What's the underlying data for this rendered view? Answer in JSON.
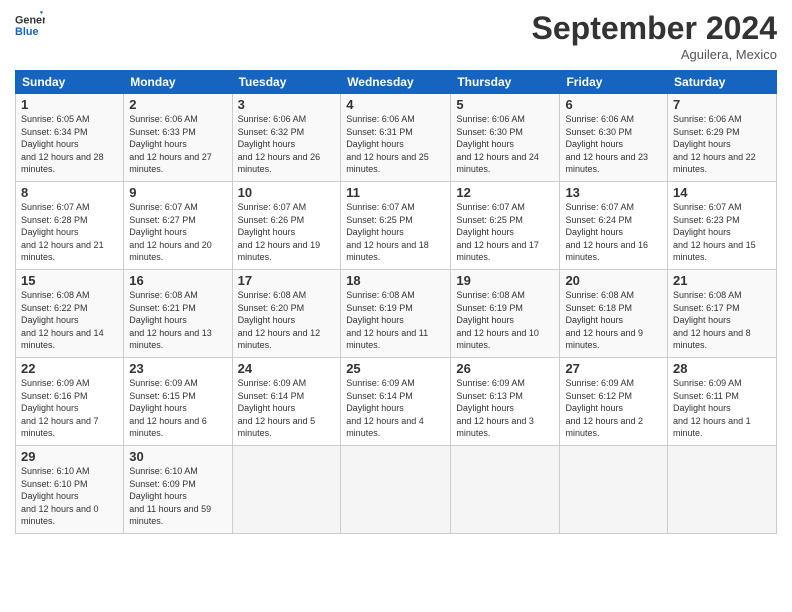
{
  "header": {
    "logo_line1": "General",
    "logo_line2": "Blue",
    "month": "September 2024",
    "location": "Aguilera, Mexico"
  },
  "weekdays": [
    "Sunday",
    "Monday",
    "Tuesday",
    "Wednesday",
    "Thursday",
    "Friday",
    "Saturday"
  ],
  "weeks": [
    [
      {
        "day": "1",
        "sunrise": "6:05 AM",
        "sunset": "6:34 PM",
        "daylight": "12 hours and 28 minutes."
      },
      {
        "day": "2",
        "sunrise": "6:06 AM",
        "sunset": "6:33 PM",
        "daylight": "12 hours and 27 minutes."
      },
      {
        "day": "3",
        "sunrise": "6:06 AM",
        "sunset": "6:32 PM",
        "daylight": "12 hours and 26 minutes."
      },
      {
        "day": "4",
        "sunrise": "6:06 AM",
        "sunset": "6:31 PM",
        "daylight": "12 hours and 25 minutes."
      },
      {
        "day": "5",
        "sunrise": "6:06 AM",
        "sunset": "6:30 PM",
        "daylight": "12 hours and 24 minutes."
      },
      {
        "day": "6",
        "sunrise": "6:06 AM",
        "sunset": "6:30 PM",
        "daylight": "12 hours and 23 minutes."
      },
      {
        "day": "7",
        "sunrise": "6:06 AM",
        "sunset": "6:29 PM",
        "daylight": "12 hours and 22 minutes."
      }
    ],
    [
      {
        "day": "8",
        "sunrise": "6:07 AM",
        "sunset": "6:28 PM",
        "daylight": "12 hours and 21 minutes."
      },
      {
        "day": "9",
        "sunrise": "6:07 AM",
        "sunset": "6:27 PM",
        "daylight": "12 hours and 20 minutes."
      },
      {
        "day": "10",
        "sunrise": "6:07 AM",
        "sunset": "6:26 PM",
        "daylight": "12 hours and 19 minutes."
      },
      {
        "day": "11",
        "sunrise": "6:07 AM",
        "sunset": "6:25 PM",
        "daylight": "12 hours and 18 minutes."
      },
      {
        "day": "12",
        "sunrise": "6:07 AM",
        "sunset": "6:25 PM",
        "daylight": "12 hours and 17 minutes."
      },
      {
        "day": "13",
        "sunrise": "6:07 AM",
        "sunset": "6:24 PM",
        "daylight": "12 hours and 16 minutes."
      },
      {
        "day": "14",
        "sunrise": "6:07 AM",
        "sunset": "6:23 PM",
        "daylight": "12 hours and 15 minutes."
      }
    ],
    [
      {
        "day": "15",
        "sunrise": "6:08 AM",
        "sunset": "6:22 PM",
        "daylight": "12 hours and 14 minutes."
      },
      {
        "day": "16",
        "sunrise": "6:08 AM",
        "sunset": "6:21 PM",
        "daylight": "12 hours and 13 minutes."
      },
      {
        "day": "17",
        "sunrise": "6:08 AM",
        "sunset": "6:20 PM",
        "daylight": "12 hours and 12 minutes."
      },
      {
        "day": "18",
        "sunrise": "6:08 AM",
        "sunset": "6:19 PM",
        "daylight": "12 hours and 11 minutes."
      },
      {
        "day": "19",
        "sunrise": "6:08 AM",
        "sunset": "6:19 PM",
        "daylight": "12 hours and 10 minutes."
      },
      {
        "day": "20",
        "sunrise": "6:08 AM",
        "sunset": "6:18 PM",
        "daylight": "12 hours and 9 minutes."
      },
      {
        "day": "21",
        "sunrise": "6:08 AM",
        "sunset": "6:17 PM",
        "daylight": "12 hours and 8 minutes."
      }
    ],
    [
      {
        "day": "22",
        "sunrise": "6:09 AM",
        "sunset": "6:16 PM",
        "daylight": "12 hours and 7 minutes."
      },
      {
        "day": "23",
        "sunrise": "6:09 AM",
        "sunset": "6:15 PM",
        "daylight": "12 hours and 6 minutes."
      },
      {
        "day": "24",
        "sunrise": "6:09 AM",
        "sunset": "6:14 PM",
        "daylight": "12 hours and 5 minutes."
      },
      {
        "day": "25",
        "sunrise": "6:09 AM",
        "sunset": "6:14 PM",
        "daylight": "12 hours and 4 minutes."
      },
      {
        "day": "26",
        "sunrise": "6:09 AM",
        "sunset": "6:13 PM",
        "daylight": "12 hours and 3 minutes."
      },
      {
        "day": "27",
        "sunrise": "6:09 AM",
        "sunset": "6:12 PM",
        "daylight": "12 hours and 2 minutes."
      },
      {
        "day": "28",
        "sunrise": "6:09 AM",
        "sunset": "6:11 PM",
        "daylight": "12 hours and 1 minute."
      }
    ],
    [
      {
        "day": "29",
        "sunrise": "6:10 AM",
        "sunset": "6:10 PM",
        "daylight": "12 hours and 0 minutes."
      },
      {
        "day": "30",
        "sunrise": "6:10 AM",
        "sunset": "6:09 PM",
        "daylight": "11 hours and 59 minutes."
      },
      null,
      null,
      null,
      null,
      null
    ]
  ]
}
